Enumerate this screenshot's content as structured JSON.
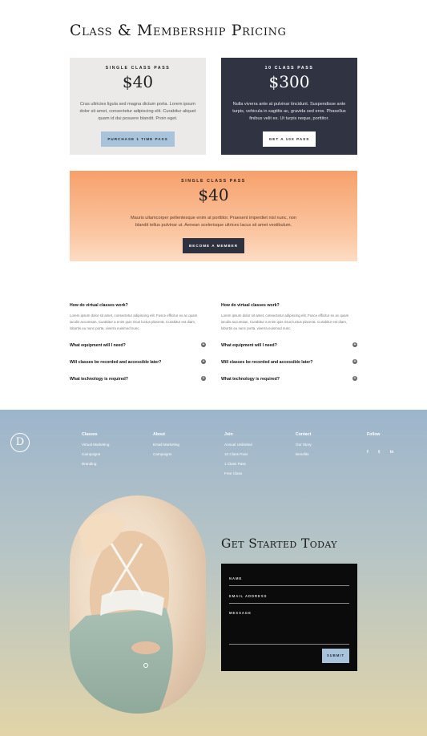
{
  "page": {
    "title": "Class & Membership Pricing"
  },
  "pricing": [
    {
      "kicker": "Single Class Pass",
      "price": "$40",
      "desc": "Cras ultricies ligula sed magna dictum porta. Lorem ipsum dolor sit amet, consectetur adipiscing elit. Curabitur aliquet quam id dui posuere blandit. Proin eget.",
      "button": "Purchase 1 Time Pass"
    },
    {
      "kicker": "10 Class Pass",
      "price": "$300",
      "desc": "Nulla viverra ante at pulvinar tincidunt. Suspendisse ante turpis, vehicula in sagittis ac, gravida sed eros. Phasellus finibus velit ex. Ut turpis neque, porttitor.",
      "button": "Get a 10x Pass"
    },
    {
      "kicker": "Single Class Pass",
      "price": "$40",
      "desc": "Mauris ullamcorper pellentesque enim at porttitor. Praesent imperdiet nisl nunc, non blandit tellus pulvinar ut. Aenean scelerisque ultrices lacus sit amet vestibulum.",
      "button": "Become a Member"
    }
  ],
  "faq": {
    "left": [
      {
        "q": "How do virtual classes work?",
        "a": "Lorem ipsum dolor sit amet, consectetur adipiscing elit. Fusce efficitur ex ac quam iaculis accumsan. Curabitur a enim quis risus luctus placerat. Curabitur est diam, lobortis eu nunc porta, viverra euismod nunc."
      },
      {
        "q": "What equipment will I need?"
      },
      {
        "q": "Will classes be recorded and accessible later?"
      },
      {
        "q": "What technology is required?"
      }
    ],
    "right": [
      {
        "q": "How do virtual classes work?",
        "a": "Lorem ipsum dolor sit amet, consectetur adipiscing elit. Fusce efficitur ex ac quam iaculis accumsan. Curabitur a enim quis risus luctus placerat. Curabitur est diam, lobortis eu nunc porta, viverra euismod nunc."
      },
      {
        "q": "What equipment will I need?"
      },
      {
        "q": "Will classes be recorded and accessible later?"
      },
      {
        "q": "What technology is required?"
      }
    ]
  },
  "footer": {
    "logo_letter": "D",
    "columns": [
      {
        "head": "Classes",
        "links": [
          "Virtual Marketing",
          "Campaigns",
          "Branding"
        ]
      },
      {
        "head": "About",
        "links": [
          "Email Marketing",
          "Campaigns"
        ]
      },
      {
        "head": "Join",
        "links": [
          "Annual Unlimited",
          "10 Class Pass",
          "1 Class Pass",
          "Free Class"
        ]
      },
      {
        "head": "Contact",
        "links": [
          "Our Story",
          "Benefits"
        ]
      }
    ],
    "follow": {
      "head": "Follow",
      "icons": [
        "facebook-icon",
        "twitter-icon",
        "linkedin-icon"
      ],
      "glyphs": [
        "f",
        "𝕥",
        "in"
      ]
    }
  },
  "cta": {
    "title": "Get Started Today",
    "fields": [
      {
        "label": "Name"
      },
      {
        "label": "Email Address"
      },
      {
        "label": "Message"
      }
    ],
    "submit": "Submit"
  },
  "colors": {
    "accent": "#a9c3da",
    "dark": "#303442",
    "peach": "#f7a06b"
  }
}
